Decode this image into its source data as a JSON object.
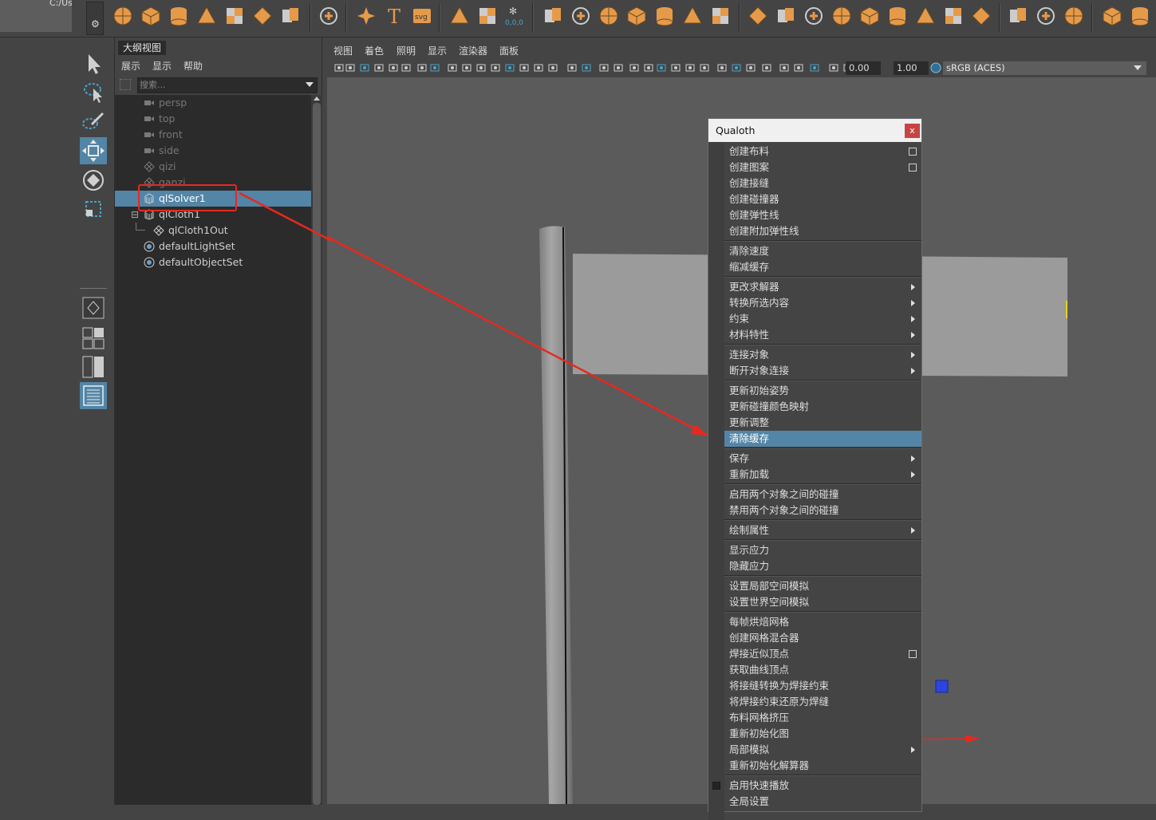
{
  "window": {
    "path_fragment": "C:/Us"
  },
  "shelf": {
    "icons": [
      "sphere-icon",
      "cube-icon",
      "cylinder-icon",
      "cone-icon",
      "torus-icon",
      "plane-icon",
      "disc-icon",
      "platonic-icon",
      "sweep-icon",
      "type-icon",
      "svg-icon",
      "pivot-icon",
      "snap-icon",
      "freeze-icon",
      "combine-icon",
      "separate-icon",
      "bool-icon",
      "grid-icon",
      "extract-icon",
      "mirror-icon",
      "smooth-icon",
      "bevel-icon",
      "bridge-icon",
      "extrude-icon",
      "split-icon",
      "insert-loop-icon",
      "offset-icon",
      "multicut-icon",
      "target-weld-icon",
      "fill-icon",
      "edit-icon",
      "wedge-icon",
      "brush-icon",
      "uv-icon",
      "wrap-icon"
    ],
    "svg_label": "svg",
    "text_label": "T",
    "coord_label": "0,0,0"
  },
  "outliner": {
    "title": "大纲视图",
    "menu": [
      "展示",
      "显示",
      "帮助"
    ],
    "search_placeholder": "搜索...",
    "items": [
      {
        "label": "persp",
        "icon": "camera-icon",
        "dim": true,
        "indent": 0
      },
      {
        "label": "top",
        "icon": "camera-icon",
        "dim": true,
        "indent": 0
      },
      {
        "label": "front",
        "icon": "camera-icon",
        "dim": true,
        "indent": 0
      },
      {
        "label": "side",
        "icon": "camera-icon",
        "dim": true,
        "indent": 0
      },
      {
        "label": "qizi",
        "icon": "mesh-icon",
        "dim": true,
        "indent": 0
      },
      {
        "label": "ganzi",
        "icon": "mesh-icon",
        "dim": true,
        "indent": 0
      },
      {
        "label": "qlSolver1",
        "icon": "solver-icon",
        "dim": false,
        "selected": true,
        "indent": 0
      },
      {
        "label": "qlCloth1",
        "icon": "cloth-icon",
        "dim": false,
        "indent": 0,
        "expand": "⊟"
      },
      {
        "label": "qlCloth1Out",
        "icon": "mesh-icon",
        "dim": false,
        "indent": 1
      },
      {
        "label": "defaultLightSet",
        "icon": "set-icon",
        "dim": false,
        "indent": 0
      },
      {
        "label": "defaultObjectSet",
        "icon": "set-icon",
        "dim": false,
        "indent": 0
      }
    ]
  },
  "panel": {
    "menu": [
      "视图",
      "着色",
      "照明",
      "显示",
      "渲染器",
      "面板"
    ],
    "exposure": "0.00",
    "gamma": "1.00",
    "color_space": "sRGB (ACES)"
  },
  "qualoth": {
    "title": "Qualoth",
    "close_label": "x",
    "groups": [
      [
        {
          "label": "创建布料",
          "box": true
        },
        {
          "label": "创建图案",
          "box": true
        },
        {
          "label": "创建接缝"
        },
        {
          "label": "创建碰撞器"
        },
        {
          "label": "创建弹性线"
        },
        {
          "label": "创建附加弹性线"
        }
      ],
      [
        {
          "label": "清除速度"
        },
        {
          "label": "缩减缓存"
        }
      ],
      [
        {
          "label": "更改求解器",
          "submenu": true
        },
        {
          "label": "转换所选内容",
          "submenu": true
        },
        {
          "label": "约束",
          "submenu": true
        },
        {
          "label": "材料特性",
          "submenu": true
        }
      ],
      [
        {
          "label": "连接对象",
          "submenu": true
        },
        {
          "label": "断开对象连接",
          "submenu": true
        }
      ],
      [
        {
          "label": "更新初始姿势"
        },
        {
          "label": "更新碰撞颜色映射"
        },
        {
          "label": "更新调整"
        },
        {
          "label": "清除缓存",
          "highlighted": true
        }
      ],
      [
        {
          "label": "保存",
          "submenu": true
        },
        {
          "label": "重新加载",
          "submenu": true
        }
      ],
      [
        {
          "label": "启用两个对象之间的碰撞"
        },
        {
          "label": "禁用两个对象之间的碰撞"
        }
      ],
      [
        {
          "label": "绘制属性",
          "submenu": true
        }
      ],
      [
        {
          "label": "显示应力"
        },
        {
          "label": "隐藏应力"
        }
      ],
      [
        {
          "label": "设置局部空间模拟"
        },
        {
          "label": "设置世界空间模拟"
        }
      ],
      [
        {
          "label": "每帧烘焙网格"
        },
        {
          "label": "创建网格混合器"
        },
        {
          "label": "焊接近似顶点",
          "box": true
        },
        {
          "label": "获取曲线顶点"
        },
        {
          "label": "将接缝转换为焊接约束"
        },
        {
          "label": "将焊接约束还原为焊缝"
        },
        {
          "label": "布料网格挤压"
        },
        {
          "label": "重新初始化图"
        },
        {
          "label": "局部模拟",
          "submenu": true
        },
        {
          "label": "重新初始化解算器"
        }
      ],
      [
        {
          "label": "启用快速播放",
          "checkbox": true
        },
        {
          "label": "全局设置"
        }
      ]
    ]
  },
  "colors": {
    "accent": "#5285a6",
    "annotation": "#e8281e",
    "shelf_orange": "#e59a4a"
  }
}
